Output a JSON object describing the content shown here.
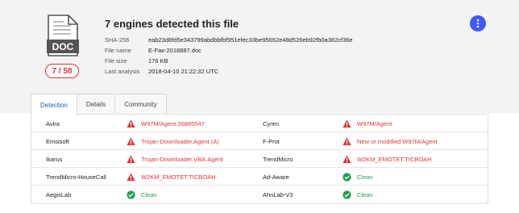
{
  "file": {
    "icon_label": "DOC",
    "icon": "doc-file-icon",
    "score": "7 / 58"
  },
  "summary": {
    "title": "7 engines detected this file",
    "fields": [
      {
        "label": "SHA-256",
        "value": "eab23d8fd5e343799abdbbfbf951efec33be95652e48d526eb92fb0a382cf36e"
      },
      {
        "label": "File name",
        "value": "E-Fax-2018887.doc"
      },
      {
        "label": "File size",
        "value": "176 KB"
      },
      {
        "label": "Last analysis",
        "value": "2018-04-10 21:22:32 UTC"
      }
    ]
  },
  "menu": {
    "icon": "vertical-dots-icon"
  },
  "tabs": [
    {
      "label": "Detection",
      "active": true
    },
    {
      "label": "Details",
      "active": false
    },
    {
      "label": "Community",
      "active": false
    }
  ],
  "results": [
    [
      {
        "engine": "Avira",
        "result": "W97M/Agent.36885547",
        "status": "malicious"
      },
      {
        "engine": "Cyren",
        "result": "W97M/Agent",
        "status": "malicious"
      }
    ],
    [
      {
        "engine": "Emsisoft",
        "result": "Trojan-Downloader.Agent (A)",
        "status": "malicious"
      },
      {
        "engine": "F-Prot",
        "result": "New or modified W97M/Agent",
        "status": "malicious"
      }
    ],
    [
      {
        "engine": "Ikarus",
        "result": "Trojan-Downloader.VBA.Agent",
        "status": "malicious"
      },
      {
        "engine": "TrendMicro",
        "result": "W2KM_EMOTET.TICBOAH",
        "status": "malicious"
      }
    ],
    [
      {
        "engine": "TrendMicro-HouseCall",
        "result": "W2KM_EMOTET.TICBOAH",
        "status": "malicious"
      },
      {
        "engine": "Ad-Aware",
        "result": "Clean",
        "status": "clean"
      }
    ],
    [
      {
        "engine": "AegisLab",
        "result": "Clean",
        "status": "clean"
      },
      {
        "engine": "AhnLab-V3",
        "result": "Clean",
        "status": "clean"
      }
    ]
  ],
  "colors": {
    "malicious": "#e0343b",
    "clean": "#1e9e4a",
    "accent": "#3d5afe"
  }
}
